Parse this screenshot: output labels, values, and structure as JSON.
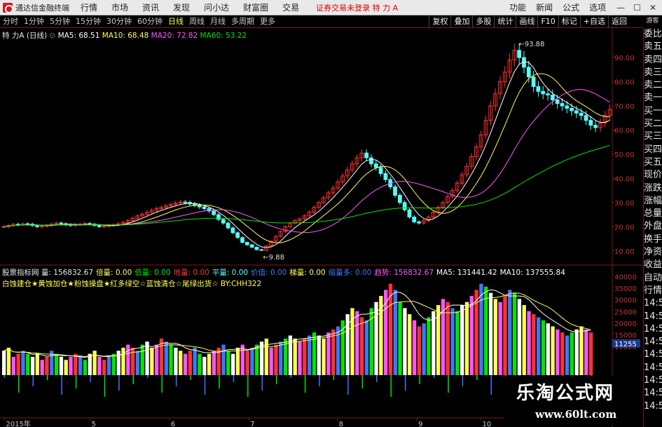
{
  "app": {
    "name": "通达信金融终端",
    "menus": [
      "行情",
      "市场",
      "资讯",
      "发现",
      "问小达",
      "财富圈",
      "交易"
    ],
    "alert": "证券交易未登录  特 力 A",
    "right_menus": [
      "功能",
      "新闻",
      "公式",
      "选项"
    ],
    "guest": "游客"
  },
  "periods": [
    "分时",
    "1分钟",
    "5分钟",
    "15分钟",
    "30分钟",
    "60分钟",
    "日线",
    "周线",
    "月线",
    "多周期",
    "更多"
  ],
  "active_period": "日线",
  "tools": [
    "复权",
    "叠加",
    "多股",
    "统计",
    "画线",
    "F10",
    "标记",
    "+自选",
    "返回"
  ],
  "main_label": {
    "title": "特 力A (日线)",
    "ma5": "MA5: 68.51",
    "ma10": "MA10: 68.48",
    "ma20": "MA20: 72.82",
    "ma60": "MA60: 53.22"
  },
  "price_axis": [
    "90.00",
    "80.00",
    "70.00",
    "60.00",
    "50.00",
    "40.00",
    "30.00",
    "20.00",
    "10.00"
  ],
  "vol_axis": [
    "40000",
    "35000",
    "30000",
    "25000",
    "20000",
    "15000",
    "10000"
  ],
  "vol_marker": "11255",
  "annotations": {
    "high": "93.88",
    "low": "9.88"
  },
  "sub_label": {
    "name": "股票指标网",
    "items": [
      "量: 156832.67",
      "倍量: 0.00",
      "低量: 0.00",
      "地量: 0.00",
      "平量: 0.00",
      "价值: 0.00",
      "梯量: 0.00",
      "缩量多: 0.00",
      "趋势: 156832.67",
      "MA5: 131441.42",
      "MA10: 137555.84"
    ]
  },
  "sub_legend": "白蚀建仓★黄蚀加仓★粉蚀操盘★红多绿空☆蓝蚀清仓☆尾绿出货☆ BY:CHH322",
  "x_axis": [
    {
      "label": "2015年",
      "pos": 0.005
    },
    {
      "label": "5",
      "pos": 0.145
    },
    {
      "label": "6",
      "pos": 0.275
    },
    {
      "label": "7",
      "pos": 0.405
    },
    {
      "label": "8",
      "pos": 0.55
    },
    {
      "label": "9",
      "pos": 0.68
    },
    {
      "label": "10",
      "pos": 0.785
    }
  ],
  "sidebar": [
    "委比",
    "卖五",
    "卖四",
    "卖三",
    "卖二",
    "卖一",
    "买一",
    "买二",
    "买三",
    "买四",
    "买五",
    "现价",
    "涨跌",
    "涨幅",
    "总量",
    "外盘",
    "换手",
    "净资",
    "收益",
    "自动",
    "行情",
    "14:5",
    "14:5",
    "14:5",
    "14:5",
    "14:5",
    "14:5",
    "14:5",
    "14:5",
    "14:5"
  ],
  "watermark": {
    "cn": "乐淘公式网",
    "url": "www.60lt.com"
  },
  "colors": {
    "up": "#ff3232",
    "down": "#54ffff",
    "ma5": "#ffffff",
    "ma10": "#ffff54",
    "ma20": "#ff54ff",
    "ma60": "#00e600",
    "grid": "#7a1a1a"
  },
  "chart_data": {
    "type": "candlestick",
    "closes": [
      20,
      20.5,
      21,
      20.8,
      21.2,
      21,
      20.5,
      20,
      20.2,
      20.6,
      21,
      21.5,
      21.2,
      20.8,
      20.5,
      20.8,
      21,
      21.3,
      21,
      20.5,
      20,
      20.2,
      20.5,
      20.8,
      21.2,
      21.8,
      22.5,
      23.5,
      24.5,
      25.2,
      26,
      26.8,
      27.5,
      28,
      28.6,
      29.2,
      29.8,
      30.2,
      30,
      29.4,
      28.8,
      28.2,
      27.5,
      26.5,
      25,
      23,
      21.5,
      19.5,
      17.5,
      15.5,
      13.5,
      12.5,
      11.5,
      10.5,
      10.2,
      12,
      14,
      16,
      18,
      20,
      21.5,
      22.5,
      23.2,
      24.5,
      26,
      28,
      30,
      32,
      34,
      36,
      38.5,
      41,
      43.5,
      46,
      48.5,
      50.5,
      48.5,
      46,
      44.5,
      42,
      39.5,
      36.5,
      33,
      30,
      27,
      24,
      22,
      21.5,
      22.5,
      24,
      26,
      28,
      30,
      32.5,
      35,
      38,
      41.5,
      45,
      49,
      53,
      58,
      64,
      70,
      75,
      80,
      84,
      89,
      93,
      90,
      86,
      82,
      78,
      76,
      75,
      74.5,
      72.5,
      71,
      70,
      69,
      68,
      67,
      66,
      64,
      62,
      61,
      63,
      66,
      68.5
    ],
    "vol_bars": [
      8,
      9,
      6,
      7,
      8,
      7,
      6,
      7,
      5,
      6,
      8,
      7,
      6,
      5,
      6,
      7,
      6,
      5,
      7,
      8,
      6,
      5,
      6,
      7,
      8,
      9,
      10,
      9,
      8,
      10,
      11,
      9,
      10,
      12,
      11,
      10,
      9,
      8,
      7,
      8,
      9,
      7,
      6,
      7,
      8,
      9,
      10,
      8,
      7,
      9,
      10,
      8,
      9,
      10,
      11,
      12,
      9,
      10,
      11,
      12,
      13,
      12,
      11,
      12,
      13,
      14,
      13,
      12,
      14,
      15,
      16,
      18,
      20,
      22,
      21,
      19,
      18,
      22,
      24,
      26,
      28,
      30,
      28,
      24,
      22,
      20,
      18,
      16,
      17,
      19,
      21,
      23,
      25,
      24,
      22,
      21,
      23,
      24,
      26,
      28,
      30,
      29,
      27,
      25,
      24,
      26,
      28,
      27,
      25,
      23,
      21,
      20,
      19,
      18,
      17,
      16,
      15,
      14,
      13,
      14,
      15,
      16,
      15,
      14
    ],
    "price_ylim": [
      5,
      97
    ],
    "vol_ylim": [
      0,
      42000
    ]
  }
}
